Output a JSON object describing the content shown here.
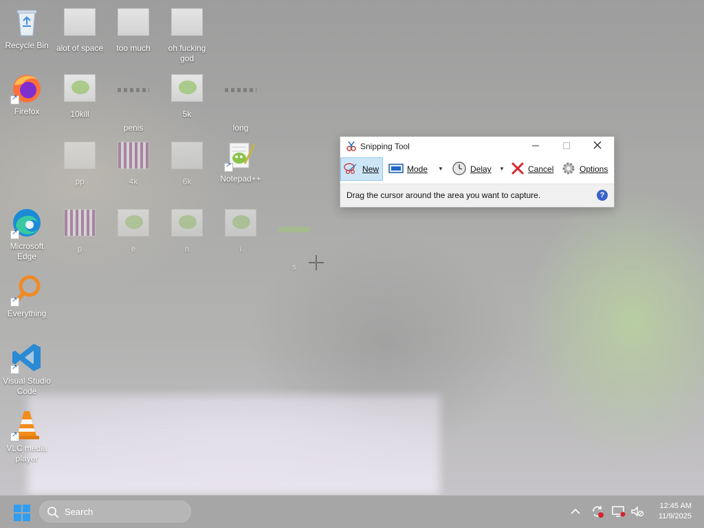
{
  "desktop": {
    "icons": [
      {
        "label": "Recycle Bin"
      },
      {
        "label": "alot of space"
      },
      {
        "label": "too much"
      },
      {
        "label": "oh fucking god"
      },
      {
        "label": "Firefox"
      },
      {
        "label": "10kill"
      },
      {
        "label": "penis"
      },
      {
        "label": "5k"
      },
      {
        "label": "long"
      },
      {
        "label": "pp"
      },
      {
        "label": "4k"
      },
      {
        "label": "6k"
      },
      {
        "label": "Notepad++"
      },
      {
        "label": "Microsoft Edge"
      },
      {
        "label": "p"
      },
      {
        "label": "e"
      },
      {
        "label": "n"
      },
      {
        "label": "i"
      },
      {
        "label": "s"
      },
      {
        "label": "Everything"
      },
      {
        "label": "Visual Studio Code"
      },
      {
        "label": "VLC media player"
      }
    ]
  },
  "snipping_tool": {
    "title": "Snipping Tool",
    "buttons": {
      "new": "New",
      "mode": "Mode",
      "delay": "Delay",
      "cancel": "Cancel",
      "options": "Options"
    },
    "status": "Drag the cursor around the area you want to capture.",
    "help": "?"
  },
  "taskbar": {
    "search_placeholder": "Search",
    "time": "12:45 AM",
    "date": "11/9/2025"
  },
  "colors": {
    "accent": "#0078d4",
    "cancel_red": "#d4252f",
    "help_blue": "#3a63c8"
  }
}
